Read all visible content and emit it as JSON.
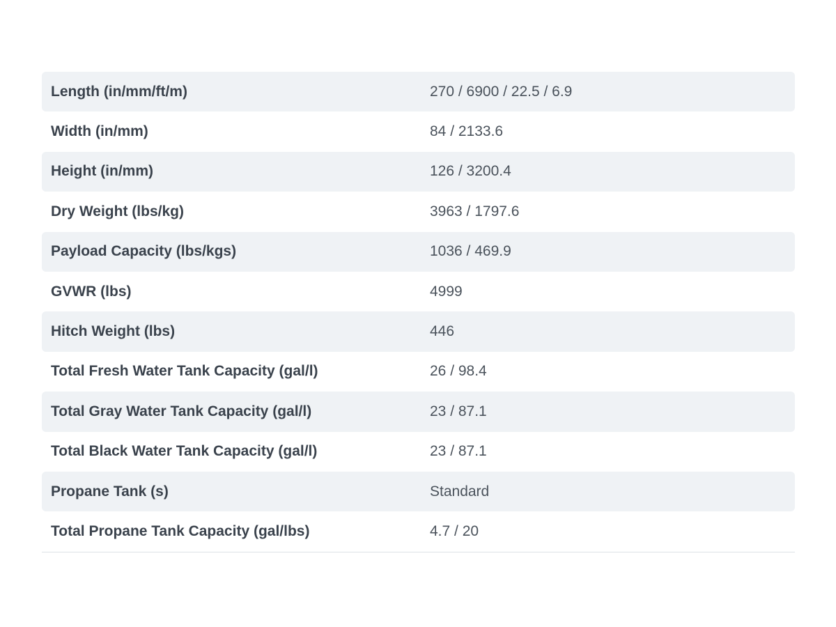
{
  "specs": {
    "rows": [
      {
        "label": "Length (in/mm/ft/m)",
        "value": "270 / 6900 / 22.5 / 6.9"
      },
      {
        "label": "Width (in/mm)",
        "value": "84 / 2133.6"
      },
      {
        "label": "Height (in/mm)",
        "value": "126 / 3200.4"
      },
      {
        "label": "Dry Weight (lbs/kg)",
        "value": "3963 / 1797.6"
      },
      {
        "label": "Payload Capacity (lbs/kgs)",
        "value": "1036 / 469.9"
      },
      {
        "label": "GVWR (lbs)",
        "value": "4999"
      },
      {
        "label": "Hitch Weight (lbs)",
        "value": "446"
      },
      {
        "label": "Total Fresh Water Tank Capacity (gal/l)",
        "value": "26 / 98.4"
      },
      {
        "label": "Total Gray Water Tank Capacity (gal/l)",
        "value": "23 / 87.1"
      },
      {
        "label": "Total Black Water Tank Capacity (gal/l)",
        "value": "23 / 87.1"
      },
      {
        "label": "Propane Tank (s)",
        "value": "Standard"
      },
      {
        "label": "Total Propane Tank Capacity (gal/lbs)",
        "value": "4.7 / 20"
      }
    ]
  },
  "colors": {
    "row_shade": "#eff2f5",
    "text": "#3a424c",
    "divider": "#dde2e6"
  }
}
